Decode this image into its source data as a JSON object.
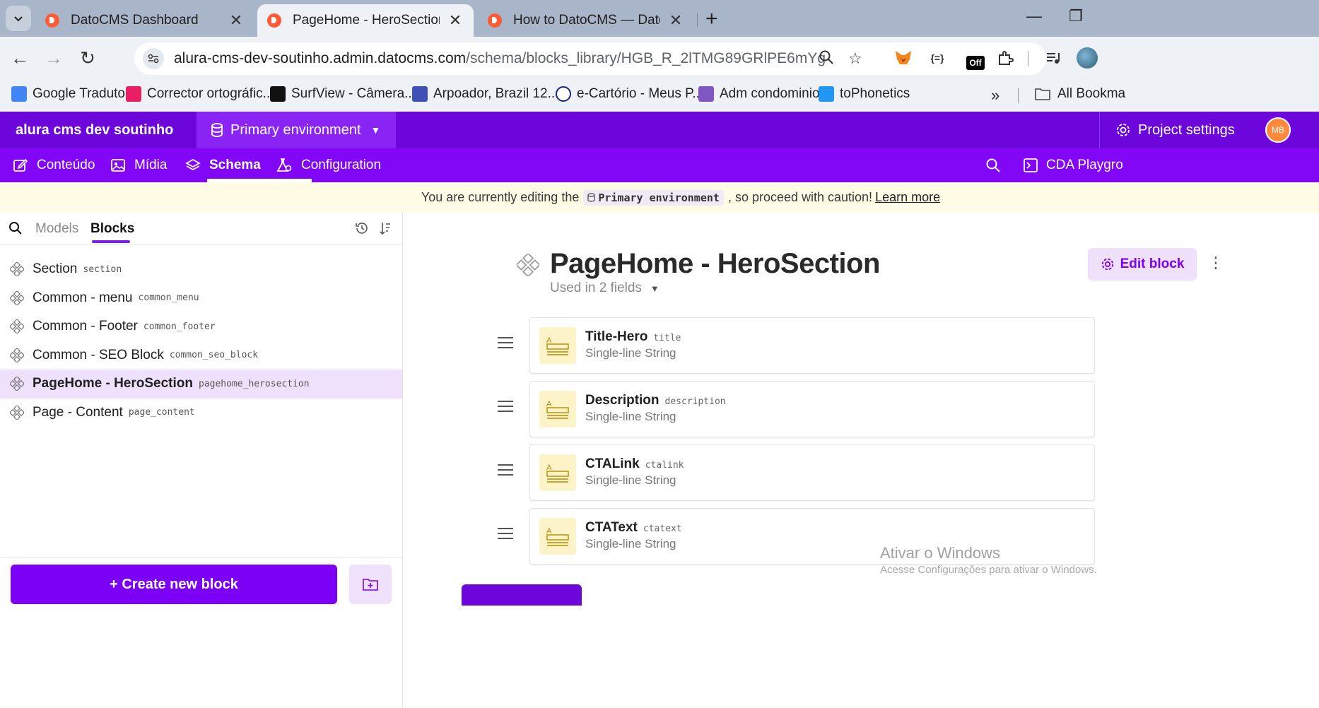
{
  "browser": {
    "tabs": [
      {
        "title": "DatoCMS Dashboard",
        "active": false
      },
      {
        "title": "PageHome - HeroSection | Bloc",
        "active": true
      },
      {
        "title": "How to DatoCMS — DatoCMS",
        "active": false
      }
    ],
    "url_host": "alura-cms-dev-soutinho.admin.datocms.com",
    "url_path": "/schema/blocks_library/HGB_R_2lTMG89GRlPE6mYg",
    "extension_badge": "Off",
    "bookmarks": [
      {
        "label": "Google Tradutor",
        "color": "#4285f4"
      },
      {
        "label": "Corrector ortográfic...",
        "color": "#e91e63"
      },
      {
        "label": "SurfView - Câmera...",
        "color": "#111111"
      },
      {
        "label": "Arpoador, Brazil 12...",
        "color": "#3f51b5"
      },
      {
        "label": "e-Cartório - Meus P...",
        "color": "#1a237e"
      },
      {
        "label": "Adm condominio",
        "color": "#7e57c2"
      },
      {
        "label": "toPhonetics",
        "color": "#2196f3"
      }
    ],
    "all_bookmarks": "All Bookma"
  },
  "app": {
    "project_name": "alura cms dev soutinho",
    "environment": "Primary environment",
    "project_settings": "Project settings",
    "avatar_initials": "MB",
    "nav": [
      {
        "label": "Conteúdo",
        "icon": "edit-icon"
      },
      {
        "label": "Mídia",
        "icon": "image-icon"
      },
      {
        "label": "Schema",
        "icon": "layers-icon",
        "active": true
      },
      {
        "label": "Configuration",
        "icon": "flask-gear-icon"
      }
    ],
    "cda_playground": "CDA Playgro",
    "colors": {
      "header": "#6c06db",
      "nav": "#8207f7",
      "accent": "#7b00f5"
    }
  },
  "warning": {
    "prefix": "You are currently editing the",
    "env_chip": "Primary environment",
    "suffix": ", so proceed with caution!",
    "link": "Learn more"
  },
  "sidebar": {
    "tab_models": "Models",
    "tab_blocks": "Blocks",
    "blocks": [
      {
        "name": "Section",
        "api": "section",
        "selected": false
      },
      {
        "name": "Common - menu",
        "api": "common_menu",
        "selected": false
      },
      {
        "name": "Common - Footer",
        "api": "common_footer",
        "selected": false
      },
      {
        "name": "Common - SEO Block",
        "api": "common_seo_block",
        "selected": false
      },
      {
        "name": "PageHome - HeroSection",
        "api": "pagehome_herosection",
        "selected": true
      },
      {
        "name": "Page - Content",
        "api": "page_content",
        "selected": false
      }
    ],
    "create_button": "+ Create new block"
  },
  "main": {
    "title": "PageHome - HeroSection",
    "used_in": "Used in 2 fields",
    "edit_block": "Edit block",
    "fields": [
      {
        "name": "Title-Hero",
        "api": "title",
        "type": "Single-line String"
      },
      {
        "name": "Description",
        "api": "description",
        "type": "Single-line String"
      },
      {
        "name": "CTALink",
        "api": "ctalink",
        "type": "Single-line String"
      },
      {
        "name": "CTAText",
        "api": "ctatext",
        "type": "Single-line String"
      }
    ]
  },
  "watermark": {
    "line1": "Ativar o Windows",
    "line2": "Acesse Configurações para ativar o Windows."
  }
}
